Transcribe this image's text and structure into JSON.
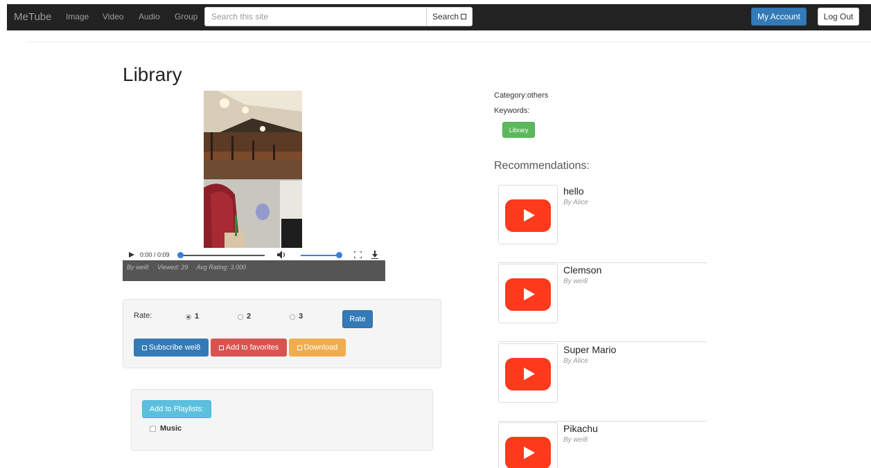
{
  "navbar": {
    "brand": "MeTube",
    "links": [
      "Image",
      "Video",
      "Audio",
      "Group"
    ],
    "search_placeholder": "Search this site",
    "search_button": "Search",
    "account_button": "My Account",
    "logout_button": "Log Out"
  },
  "page": {
    "title": "Library"
  },
  "player": {
    "time": "0:00 / 0:09",
    "progress": 0.0,
    "volume": 0.9
  },
  "meta": {
    "by": "By wei8",
    "viewed": "Viewed: 29",
    "rating": "Avg Rating: 3.000"
  },
  "rating_panel": {
    "label": "Rate:",
    "options": [
      "1",
      "2",
      "3"
    ],
    "selected": "1",
    "rate_button": "Rate",
    "subscribe_button": "Subscribe wei8",
    "favorites_button": "Add to favorites",
    "download_button": "Download",
    "colors": {
      "primary": "#337ab7",
      "danger": "#d9534f",
      "warning": "#f0ad4e"
    }
  },
  "playlist_panel": {
    "button": "Add to Playlists:",
    "items": [
      {
        "label": "Music",
        "checked": false
      }
    ]
  },
  "details": {
    "category": "Category:others",
    "keywords_label": "Keywords:",
    "keywords": [
      "Library"
    ]
  },
  "recommendations": {
    "heading": "Recommendations:",
    "items": [
      {
        "title": "hello",
        "author": "By Alice"
      },
      {
        "title": "Clemson",
        "author": "By wei8"
      },
      {
        "title": "Super Mario",
        "author": "By Alice"
      },
      {
        "title": "Pikachu",
        "author": "By wei8"
      }
    ]
  }
}
